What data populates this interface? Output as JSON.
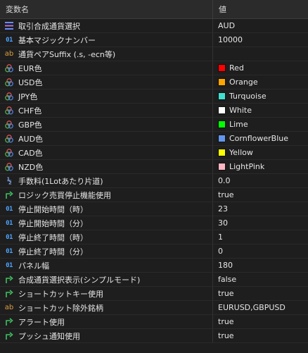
{
  "header": {
    "name_col": "変数名",
    "value_col": "値"
  },
  "rows": [
    {
      "label": "取引合成通貨選択",
      "value": "AUD",
      "icon": "enum-list-icon",
      "icon_type": "enum"
    },
    {
      "label": "基本マジックナンバー",
      "value": "10000",
      "icon": "integer-icon",
      "icon_type": "int"
    },
    {
      "label": "通貨ペアSuffix (.s, -ecn等)",
      "value": "",
      "icon": "string-icon",
      "icon_type": "str"
    },
    {
      "label": "EUR色",
      "value": "Red",
      "icon": "color-palette-icon",
      "icon_type": "color",
      "color": "#ff0000"
    },
    {
      "label": "USD色",
      "value": "Orange",
      "icon": "color-palette-icon",
      "icon_type": "color",
      "color": "#ffa500"
    },
    {
      "label": "JPY色",
      "value": "Turquoise",
      "icon": "color-palette-icon",
      "icon_type": "color",
      "color": "#40e0d0"
    },
    {
      "label": "CHF色",
      "value": "White",
      "icon": "color-palette-icon",
      "icon_type": "color",
      "color": "#ffffff"
    },
    {
      "label": "GBP色",
      "value": "Lime",
      "icon": "color-palette-icon",
      "icon_type": "color",
      "color": "#00ff00"
    },
    {
      "label": "AUD色",
      "value": "CornflowerBlue",
      "icon": "color-palette-icon",
      "icon_type": "color",
      "color": "#6495ed"
    },
    {
      "label": "CAD色",
      "value": "Yellow",
      "icon": "color-palette-icon",
      "icon_type": "color",
      "color": "#ffff00"
    },
    {
      "label": "NZD色",
      "value": "LightPink",
      "icon": "color-palette-icon",
      "icon_type": "color",
      "color": "#ffb6c1"
    },
    {
      "label": "手数料(1Lotあたり片道)",
      "value": "0.0",
      "icon": "double-fraction-icon",
      "icon_type": "double"
    },
    {
      "label": "ロジック売買停止機能使用",
      "value": "true",
      "icon": "bool-arrow-icon",
      "icon_type": "bool"
    },
    {
      "label": "停止開始時間（時）",
      "value": "23",
      "icon": "integer-icon",
      "icon_type": "int"
    },
    {
      "label": "停止開始時間（分）",
      "value": "30",
      "icon": "integer-icon",
      "icon_type": "int"
    },
    {
      "label": "停止終了時間（時）",
      "value": "1",
      "icon": "integer-icon",
      "icon_type": "int"
    },
    {
      "label": "停止終了時間（分）",
      "value": "0",
      "icon": "integer-icon",
      "icon_type": "int"
    },
    {
      "label": "パネル幅",
      "value": "180",
      "icon": "integer-icon",
      "icon_type": "int"
    },
    {
      "label": "合成通貨選択表示(シンプルモード)",
      "value": "false",
      "icon": "bool-arrow-icon",
      "icon_type": "bool"
    },
    {
      "label": "ショートカットキー使用",
      "value": "true",
      "icon": "bool-arrow-icon",
      "icon_type": "bool"
    },
    {
      "label": "ショートカット除外銘柄",
      "value": "EURUSD,GBPUSD",
      "icon": "string-icon",
      "icon_type": "str"
    },
    {
      "label": "アラート使用",
      "value": "true",
      "icon": "bool-arrow-icon",
      "icon_type": "bool"
    },
    {
      "label": "プッシュ通知使用",
      "value": "true",
      "icon": "bool-arrow-icon",
      "icon_type": "bool"
    }
  ],
  "icon_glyphs": {
    "int": "01",
    "str": "ab",
    "double": "½"
  }
}
